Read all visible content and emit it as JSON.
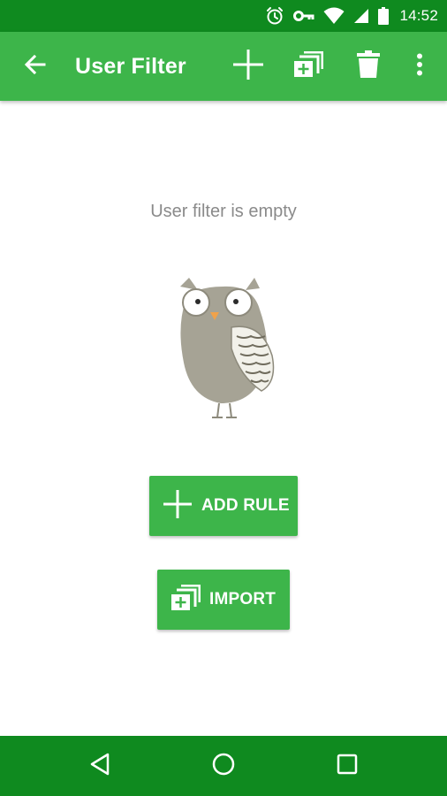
{
  "status_bar": {
    "time": "14:52",
    "icons": [
      "alarm-icon",
      "vpn-key-icon",
      "wifi-icon",
      "cell-signal-icon",
      "battery-icon"
    ]
  },
  "app_bar": {
    "title": "User Filter",
    "actions": [
      "add-icon",
      "import-icon",
      "delete-icon",
      "more-vert-icon"
    ]
  },
  "main": {
    "empty_message": "User filter is empty",
    "illustration": "owl-illustration",
    "add_rule_label": "ADD RULE",
    "import_label": "IMPORT"
  },
  "nav_bar": {
    "buttons": [
      "back-triangle-icon",
      "home-circle-icon",
      "recents-square-icon"
    ]
  },
  "colors": {
    "app_bar": "#3db54a",
    "status_bar": "#0f8a1f",
    "nav_bar": "#0f8a1f",
    "button": "#3db54a",
    "empty_text": "#8a8a8a"
  }
}
